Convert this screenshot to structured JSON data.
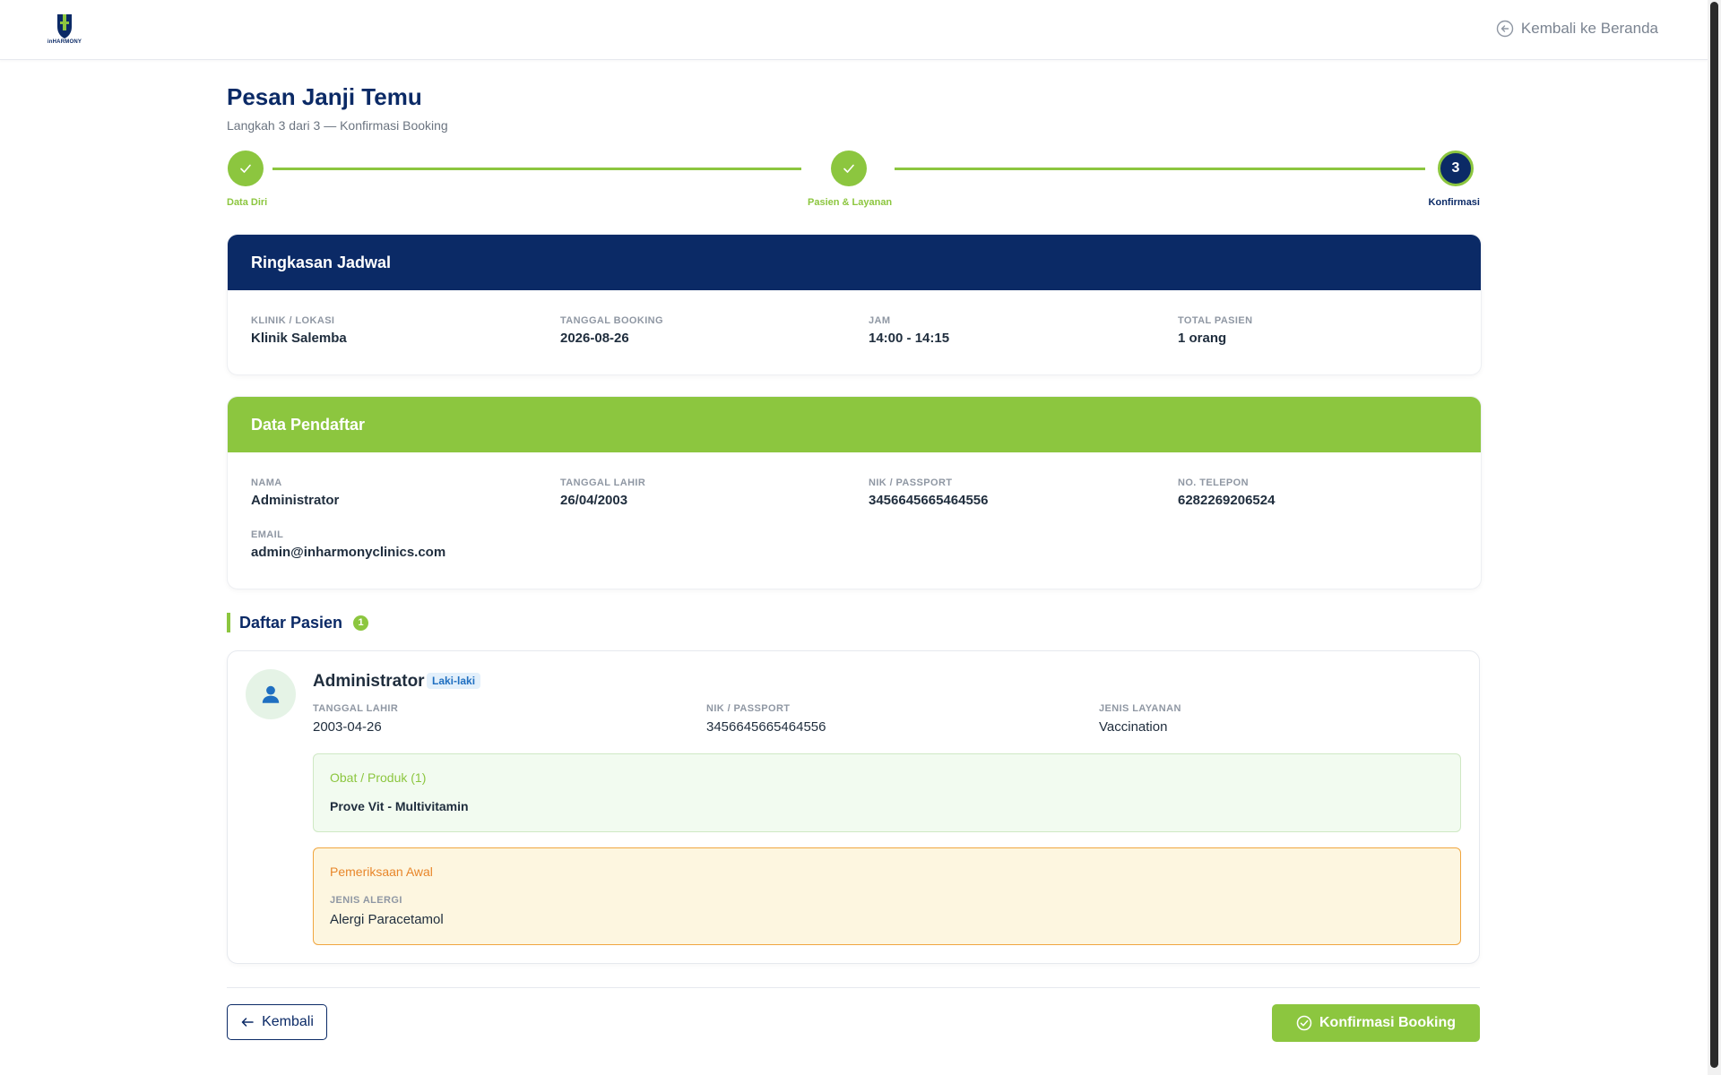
{
  "header": {
    "logo_text": "inHARMONY",
    "back_home_label": "Kembali ke Beranda"
  },
  "page": {
    "title": "Pesan Janji Temu",
    "subtitle": "Langkah 3 dari 3 — Konfirmasi Booking"
  },
  "stepper": {
    "steps": [
      {
        "label": "Data Diri",
        "status": "done"
      },
      {
        "label": "Pasien & Layanan",
        "status": "done"
      },
      {
        "label": "Konfirmasi",
        "status": "active",
        "number": "3"
      }
    ]
  },
  "schedule": {
    "title": "Ringkasan Jadwal",
    "fields": [
      {
        "label": "KLINIK / LOKASI",
        "value": "Klinik Salemba"
      },
      {
        "label": "TANGGAL BOOKING",
        "value": "2026-08-26"
      },
      {
        "label": "JAM",
        "value": "14:00 - 14:15"
      },
      {
        "label": "TOTAL PASIEN",
        "value": "1 orang"
      }
    ]
  },
  "registrant": {
    "title": "Data Pendaftar",
    "fields": [
      {
        "label": "NAMA",
        "value": "Administrator"
      },
      {
        "label": "TANGGAL LAHIR",
        "value": "26/04/2003"
      },
      {
        "label": "NIK / PASSPORT",
        "value": "3456645665464556"
      },
      {
        "label": "NO. TELEPON",
        "value": "6282269206524"
      },
      {
        "label": "EMAIL",
        "value": "admin@inharmonyclinics.com"
      }
    ]
  },
  "patients": {
    "title": "Daftar Pasien",
    "count": "1",
    "items": [
      {
        "name": "Administrator",
        "gender": "Laki-laki",
        "fields": [
          {
            "label": "TANGGAL LAHIR",
            "value": "2003-04-26"
          },
          {
            "label": "NIK / PASSPORT",
            "value": "3456645665464556"
          },
          {
            "label": "JENIS LAYANAN",
            "value": "Vaccination"
          }
        ],
        "products": {
          "title": "Obat / Produk (1)",
          "items": [
            "Prove Vit - Multivitamin"
          ]
        },
        "initial_exam": {
          "title": "Pemeriksaan Awal",
          "label": "JENIS ALERGI",
          "value": "Alergi Paracetamol"
        }
      }
    ]
  },
  "actions": {
    "back_label": "Kembali",
    "confirm_label": "Konfirmasi Booking"
  },
  "colors": {
    "navy": "#0b2a66",
    "green": "#8cc63f",
    "orange": "#e8862a"
  }
}
